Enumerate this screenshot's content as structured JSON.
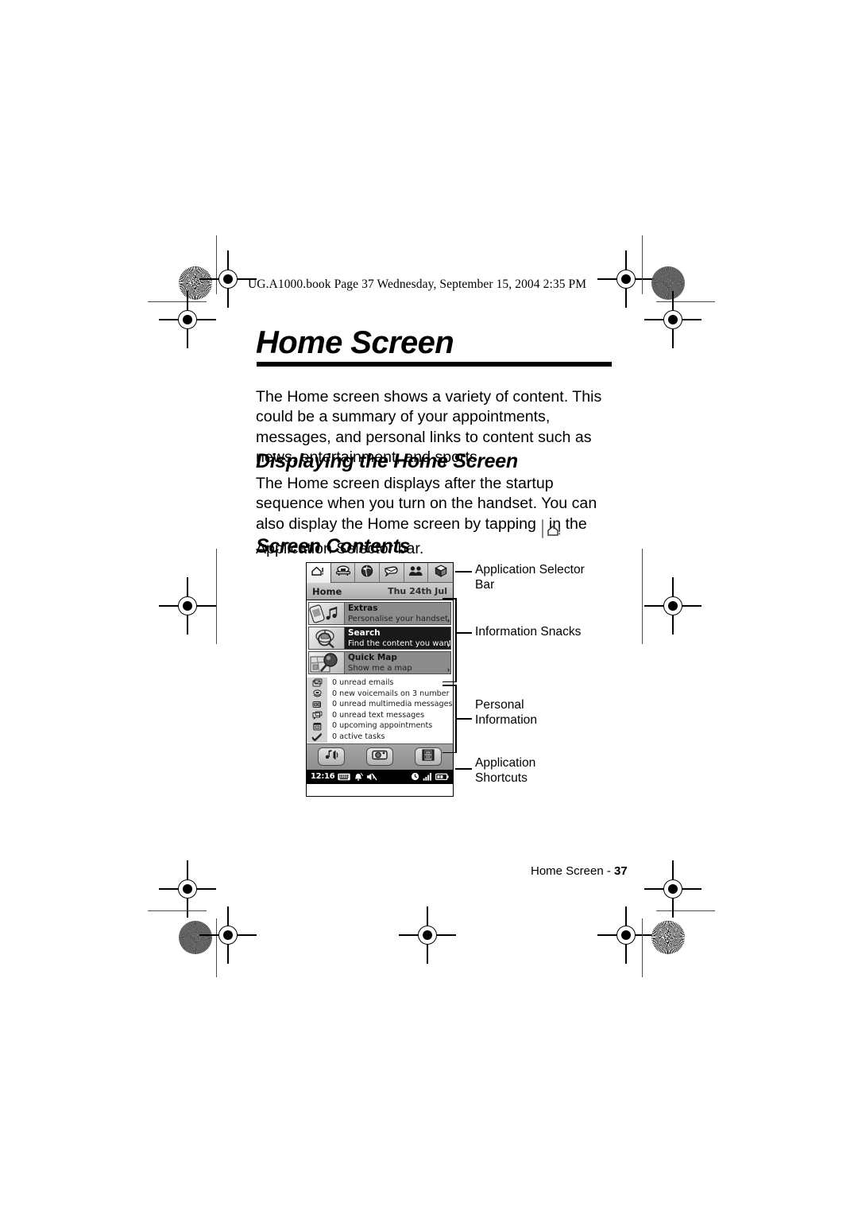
{
  "document": {
    "file_stamp": "UG.A1000.book  Page 37  Wednesday, September 15, 2004  2:35 PM",
    "title": "Home Screen",
    "footer_label": "Home Screen - ",
    "footer_page": "37"
  },
  "content": {
    "intro_paragraph": "The Home screen shows a variety of content. This could be a summary of your appointments, messages, and personal links to content such as news, entertainment, and sports.",
    "heading_displaying": "Displaying the Home Screen",
    "displaying_text_before": "The Home screen displays after the startup sequence when you turn on the handset. You can also display the Home screen by tapping",
    "displaying_text_after": "in the Application Selector bar.",
    "heading_screen_contents": "Screen Contents"
  },
  "callouts": [
    {
      "line1": "Application Selector",
      "line2": "Bar"
    },
    {
      "line1": "Information Snacks",
      "line2": ""
    },
    {
      "line1": "Personal",
      "line2": "Information"
    },
    {
      "line1": "Application",
      "line2": "Shortcuts"
    }
  ],
  "device": {
    "app_selector": [
      {
        "icon": "home-icon",
        "active": true
      },
      {
        "icon": "phone-icon",
        "active": false
      },
      {
        "icon": "globe-icon",
        "active": false
      },
      {
        "icon": "messaging-icon",
        "active": false
      },
      {
        "icon": "contacts-icon",
        "active": false
      },
      {
        "icon": "applications-box-icon",
        "active": false
      }
    ],
    "title_bar": {
      "title": "Home",
      "date": "Thu 24th Jul"
    },
    "snacks": [
      {
        "title": "Extras",
        "subtitle": "Personalise your handset",
        "theme": "grey",
        "icon": "phone-music-icon",
        "arrow": "›"
      },
      {
        "title": "Search",
        "subtitle": "Find the content you want",
        "theme": "dark",
        "icon": "magnifier-search-icon",
        "arrow": "›"
      },
      {
        "title": "Quick Map",
        "subtitle": "Show me a map",
        "theme": "grey",
        "icon": "map-magnifier-icon",
        "arrow": "›"
      }
    ],
    "personal_information": [
      {
        "text": "0 unread emails",
        "icon": "email-icon"
      },
      {
        "text": "0 new voicemails on 3 number",
        "icon": "voicemail-icon"
      },
      {
        "text": "0 unread multimedia messages",
        "icon": "multimedia-message-icon"
      },
      {
        "text": "0 unread text messages",
        "icon": "text-message-icon"
      },
      {
        "text": "0 upcoming appointments",
        "icon": "calendar-icon"
      },
      {
        "text": "0 active tasks",
        "icon": "checkmark-tasks-icon"
      }
    ],
    "shortcuts": [
      {
        "icon": "music-player-icon"
      },
      {
        "icon": "camera-icon"
      },
      {
        "icon": "video-film-icon"
      }
    ],
    "status_bar": {
      "time": "12:16",
      "left_icons": [
        "keyboard-icon",
        "alarm-bell-icon",
        "speaker-muted-icon"
      ],
      "right_icons": [
        "clock-icon",
        "signal-strength-icon",
        "battery-icon"
      ]
    }
  },
  "colors": {
    "page_background": "#ffffff",
    "ink": "#000000",
    "device_chrome": "#b6b6b6",
    "snack_dark": "#191919",
    "snack_grey": "#8c8c8c",
    "status_bar": "#000000"
  }
}
